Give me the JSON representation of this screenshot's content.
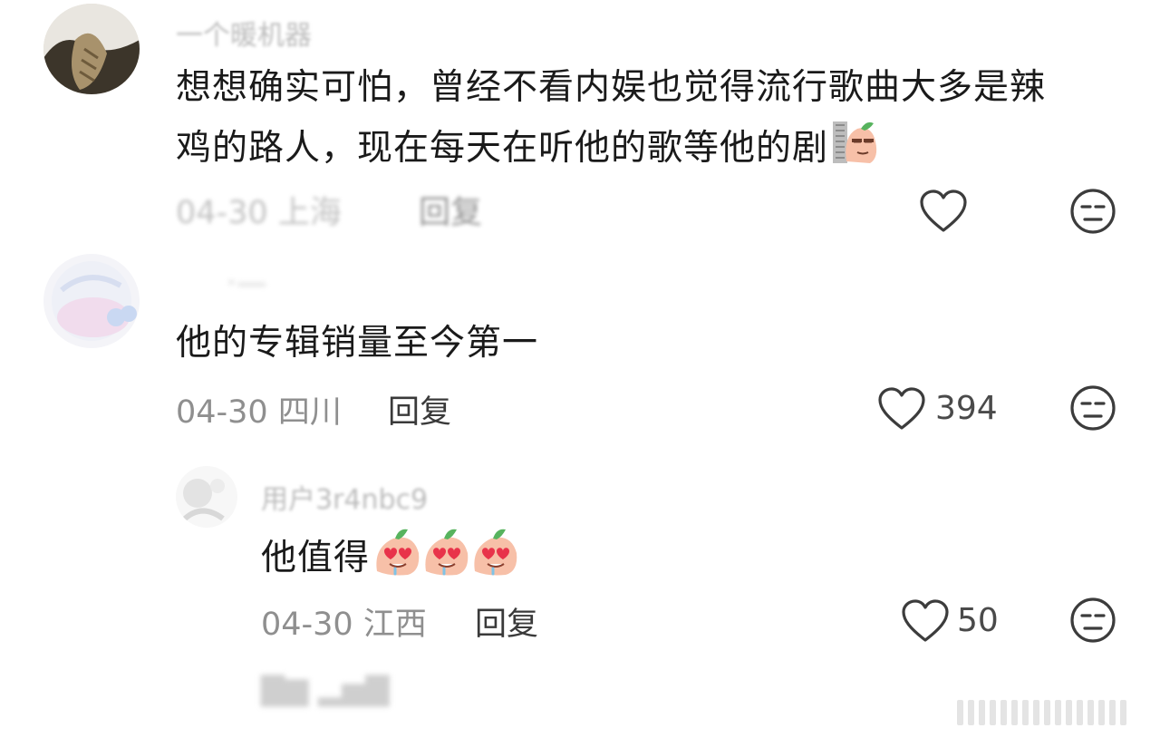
{
  "comments": [
    {
      "name": "一个暖机器",
      "content_line1": "想想确实可怕，曾经不看内娱也觉得流行歌曲大多是辣",
      "content_line2": "鸡的路人，现在每天在听他的歌等他的剧",
      "meta": "04-30 上海",
      "reply": "回复",
      "likes": "",
      "emoji": "peach-doge-emoji"
    },
    {
      "name": "",
      "content": "他的专辑销量至今第一",
      "meta": "04-30 四川",
      "reply": "回复",
      "likes": "394"
    },
    {
      "name": "用户3r4nbc9",
      "content": "他值得",
      "meta": "04-30 江西",
      "reply": "回复",
      "likes": "50",
      "emoji": "peach-heart-eyes-emoji"
    }
  ],
  "colors": {
    "text": "#1a1a1a",
    "meta": "#8f8f8f",
    "icon": "#3c3c3c",
    "peach": "#f7c0a8",
    "heart_eye": "#e8334a"
  }
}
